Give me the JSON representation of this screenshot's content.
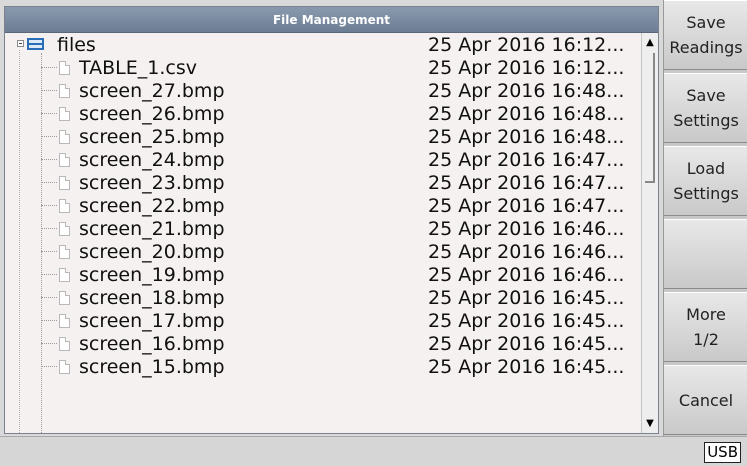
{
  "window": {
    "title": "File Management"
  },
  "tree": {
    "root": {
      "name": "files",
      "date": "25 Apr 2016 16:12..."
    },
    "items": [
      {
        "name": "TABLE_1.csv",
        "date": "25 Apr 2016 16:12..."
      },
      {
        "name": "screen_27.bmp",
        "date": "25 Apr 2016 16:48..."
      },
      {
        "name": "screen_26.bmp",
        "date": "25 Apr 2016 16:48..."
      },
      {
        "name": "screen_25.bmp",
        "date": "25 Apr 2016 16:48..."
      },
      {
        "name": "screen_24.bmp",
        "date": "25 Apr 2016 16:47..."
      },
      {
        "name": "screen_23.bmp",
        "date": "25 Apr 2016 16:47..."
      },
      {
        "name": "screen_22.bmp",
        "date": "25 Apr 2016 16:47..."
      },
      {
        "name": "screen_21.bmp",
        "date": "25 Apr 2016 16:46..."
      },
      {
        "name": "screen_20.bmp",
        "date": "25 Apr 2016 16:46..."
      },
      {
        "name": "screen_19.bmp",
        "date": "25 Apr 2016 16:46..."
      },
      {
        "name": "screen_18.bmp",
        "date": "25 Apr 2016 16:45..."
      },
      {
        "name": "screen_17.bmp",
        "date": "25 Apr 2016 16:45..."
      },
      {
        "name": "screen_16.bmp",
        "date": "25 Apr 2016 16:45..."
      },
      {
        "name": "screen_15.bmp",
        "date": "25 Apr 2016 16:45..."
      }
    ]
  },
  "softkeys": {
    "save_readings": [
      "Save",
      "Readings"
    ],
    "save_settings": [
      "Save",
      "Settings"
    ],
    "load_settings": [
      "Load",
      "Settings"
    ],
    "blank": "",
    "more": [
      "More",
      "1/2"
    ],
    "cancel": "Cancel"
  },
  "statusbar": {
    "usb": "USB"
  },
  "icons": {
    "expander": "collapse-minus-icon",
    "folder": "folder-icon",
    "file": "file-icon",
    "scroll_up": "scroll-up-arrow-icon",
    "scroll_down": "scroll-down-arrow-icon"
  },
  "colors": {
    "titlebar": "#7a8aa0",
    "folder_accent": "#2a6fb6",
    "list_background": "#f6f1f1",
    "softkey_background": "#d8d8d8"
  }
}
